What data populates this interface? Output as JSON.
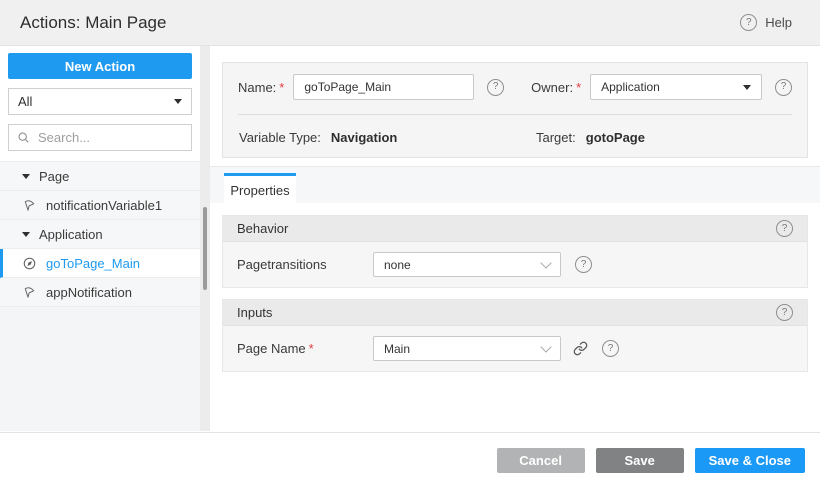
{
  "header": {
    "title": "Actions: Main Page",
    "help_label": "Help"
  },
  "icons": {
    "help_glyph": "?"
  },
  "misc": {
    "required_marker": "*"
  },
  "sidebar": {
    "new_action_label": "New Action",
    "filter_value": "All",
    "search_placeholder": "Search...",
    "tree": [
      {
        "type": "group",
        "label": "Page",
        "icon": "caret-down-icon"
      },
      {
        "type": "item",
        "label": "notificationVariable1",
        "icon": "notification-icon",
        "selected": false
      },
      {
        "type": "group",
        "label": "Application",
        "icon": "caret-down-icon"
      },
      {
        "type": "item",
        "label": "goToPage_Main",
        "icon": "navigation-icon",
        "selected": true
      },
      {
        "type": "item",
        "label": "appNotification",
        "icon": "notification-icon",
        "selected": false
      }
    ]
  },
  "form": {
    "name_label": "Name:",
    "name_value": "goToPage_Main",
    "owner_label": "Owner:",
    "owner_value": "Application",
    "variable_type_label": "Variable Type:",
    "variable_type_value": "Navigation",
    "target_label": "Target:",
    "target_value": "gotoPage"
  },
  "tabs": [
    {
      "label": "Properties",
      "active": true
    }
  ],
  "sections": [
    {
      "title": "Behavior",
      "fields": [
        {
          "label": "Pagetransitions",
          "value": "none",
          "required": false,
          "has_link": false
        }
      ]
    },
    {
      "title": "Inputs",
      "fields": [
        {
          "label": "Page Name",
          "value": "Main",
          "required": true,
          "has_link": true
        }
      ]
    }
  ],
  "footer": {
    "buttons": [
      {
        "label": "Cancel"
      },
      {
        "label": "Save"
      },
      {
        "label": "Save & Close"
      }
    ]
  },
  "colors": {
    "accent_blue": "#1e9af0",
    "header_bg": "#f0f0f1",
    "panel_bg": "#f5f5f6",
    "section_header_bg": "#eaeaeb",
    "cancel_button_bg": "#b1b3b4",
    "save_button_bg": "#808284",
    "save_close_button_bg": "#1b99f6",
    "required_marker": "#e5393c"
  }
}
